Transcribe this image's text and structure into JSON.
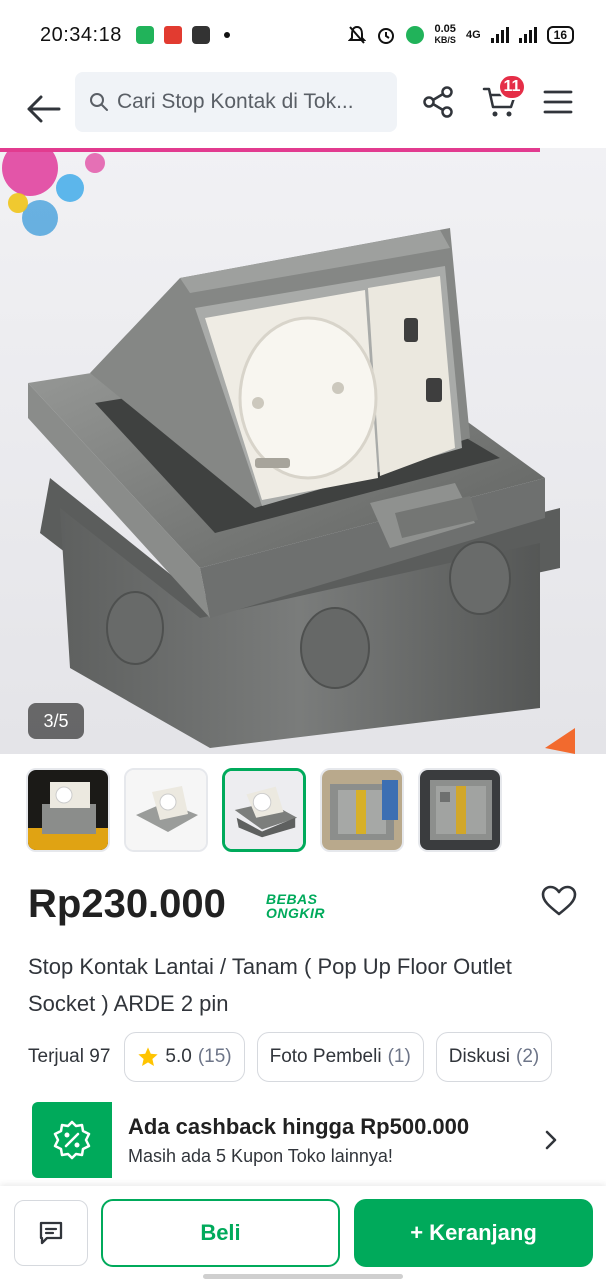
{
  "status_bar": {
    "time": "20:34:18",
    "net_speed_value": "0.05",
    "net_speed_unit": "KB/S",
    "network": "4G",
    "battery": "16"
  },
  "nav": {
    "search_placeholder": "Cari Stop Kontak di Tok...",
    "cart_count": "11"
  },
  "gallery": {
    "counter": "3/5",
    "active_index": 3,
    "total": 5
  },
  "product": {
    "price": "Rp230.000",
    "shipping_line1": "BEBAS",
    "shipping_line2": "ONGKIR",
    "title": "Stop Kontak Lantai / Tanam ( Pop Up Floor Outlet Socket ) ARDE 2 pin",
    "sold": "Terjual 97",
    "rating": "5.0",
    "rating_count": "(15)",
    "photo_label": "Foto Pembeli",
    "photo_count": "(1)",
    "discussion_label": "Diskusi",
    "discussion_count": "(2)"
  },
  "cashback": {
    "title": "Ada cashback hingga Rp500.000",
    "subtitle": "Masih ada 5 Kupon Toko lainnya!"
  },
  "actions": {
    "buy": "Beli",
    "add_to_cart": "+ Keranjang"
  },
  "colors": {
    "brand_green": "#00aa5b",
    "badge_red": "#e52e47",
    "star": "#ffc400"
  }
}
